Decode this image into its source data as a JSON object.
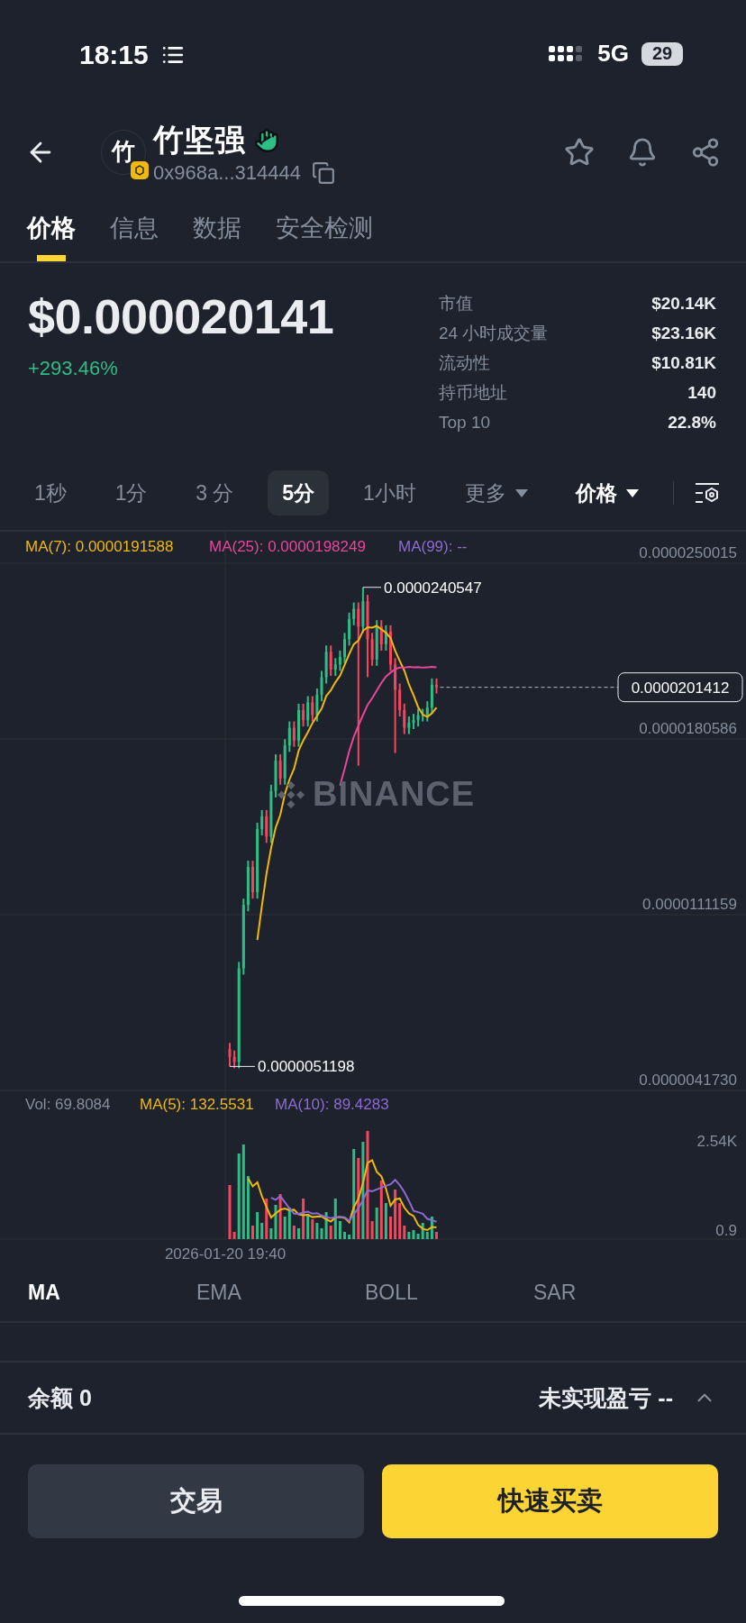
{
  "status_bar": {
    "time": "18:15",
    "network": "5G",
    "battery": "29"
  },
  "token": {
    "avatar_letter": "竹",
    "name": "竹坚强",
    "address": "0x968a...314444"
  },
  "tabs": [
    {
      "label": "价格",
      "selected": true
    },
    {
      "label": "信息",
      "selected": false
    },
    {
      "label": "数据",
      "selected": false
    },
    {
      "label": "安全检测",
      "selected": false
    }
  ],
  "price": {
    "value": "$0.000020141",
    "change": "+293.46%"
  },
  "stats": [
    {
      "label": "市值",
      "value": "$20.14K"
    },
    {
      "label": "24 小时成交量",
      "value": "$23.16K"
    },
    {
      "label": "流动性",
      "value": "$10.81K"
    },
    {
      "label": "持币地址",
      "value": "140"
    },
    {
      "label": "Top 10",
      "value": "22.8%"
    }
  ],
  "intervals": [
    {
      "label": "1秒",
      "kind": "plain",
      "selected": false
    },
    {
      "label": "1分",
      "kind": "plain",
      "selected": false
    },
    {
      "label": "3 分",
      "kind": "plain",
      "selected": false
    },
    {
      "label": "5分",
      "kind": "plain",
      "selected": true
    },
    {
      "label": "1小时",
      "kind": "plain",
      "selected": false
    },
    {
      "label": "更多",
      "kind": "dropdown",
      "selected": false
    },
    {
      "label": "价格",
      "kind": "dropdown",
      "selected": false
    }
  ],
  "chart": {
    "ma_legend": [
      {
        "label": "MA(7): 0.0000191588",
        "color": "#f0b90b"
      },
      {
        "label": "MA(25): 0.0000198249",
        "color": "#e8469a"
      },
      {
        "label": "MA(99): --",
        "color": "#8e6bd1"
      }
    ],
    "axis_labels": [
      "0.0000250015",
      "0.0000180586",
      "0.0000111159",
      "0.0000041730"
    ],
    "high_label": "0.0000240547",
    "low_label": "0.0000051198",
    "current_price": "0.0000201412",
    "watermark": "BINANCE"
  },
  "volume": {
    "legend": [
      {
        "label": "Vol: 69.8084",
        "color": "#848e9c"
      },
      {
        "label": "MA(5): 132.5531",
        "color": "#f0b90b"
      },
      {
        "label": "MA(10): 89.4283",
        "color": "#8e6bd1"
      }
    ],
    "axis_labels": [
      "2.54K",
      "0.9"
    ],
    "time_label": "2026-01-20 19:40"
  },
  "indicators": [
    {
      "label": "MA",
      "selected": true
    },
    {
      "label": "EMA",
      "selected": false
    },
    {
      "label": "BOLL",
      "selected": false
    },
    {
      "label": "SAR",
      "selected": false
    }
  ],
  "balance": {
    "label": "余额 0",
    "pnl": "未实现盈亏 --"
  },
  "buttons": [
    {
      "label": "交易",
      "kind": "secondary"
    },
    {
      "label": "快速买卖",
      "kind": "primary"
    }
  ]
}
